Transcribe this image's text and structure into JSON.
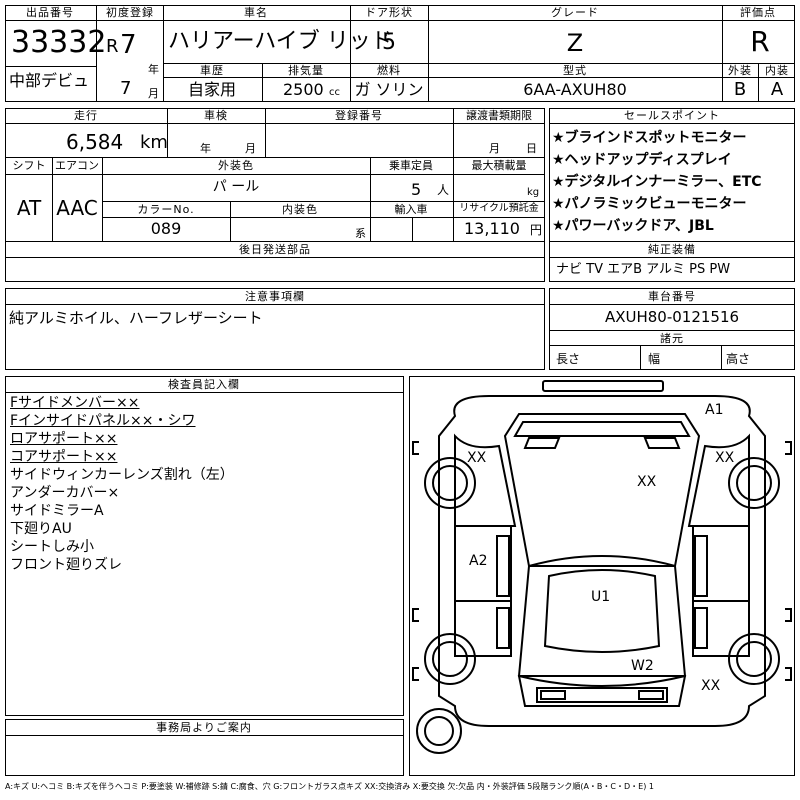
{
  "header_labels": {
    "lot_no": "出品番号",
    "first_reg": "初度登録",
    "car_name": "車名",
    "door": "ドア形状",
    "grade": "グレード",
    "score": "評価点",
    "year_unit": "年",
    "month_unit": "月",
    "history": "車歴",
    "displacement": "排気量",
    "fuel": "燃料",
    "model_code": "型式",
    "exterior": "外装",
    "interior": "内装"
  },
  "vehicle": {
    "lot_no": "33332",
    "first_reg_era": "R",
    "first_reg_year": "7",
    "first_reg_month": "7",
    "name": "ハリアーハイブ リッド",
    "debut": "中部デビュ",
    "door": "5",
    "grade": "Z",
    "score": "R",
    "history": "自家用",
    "displacement": "2500",
    "displacement_unit": "cc",
    "fuel": "ガ ソリン",
    "model_code": "6AA-AXUH80",
    "exterior_score": "B",
    "interior_score": "A"
  },
  "mid_labels": {
    "mileage": "走行",
    "inspection": "車検",
    "reg_no": "登録番号",
    "transfer_docs": "譲渡書類期限",
    "sales_points": "セールスポイント",
    "shift": "シフト",
    "aircon": "エアコン",
    "ext_color": "外装色",
    "capacity": "乗車定員",
    "max_load": "最大積載量",
    "color_no": "カラーNo.",
    "int_color": "内装色",
    "import": "輸入車",
    "recycle": "リサイクル預託金",
    "later_parts": "後日発送部品",
    "genuine": "純正装備",
    "inspection_year": "年",
    "inspection_month": "月",
    "docs_month": "月",
    "docs_day": "日",
    "capacity_unit": "人",
    "load_unit": "kg",
    "int_color_unit": "系",
    "recycle_unit": "円"
  },
  "details": {
    "mileage": "6,584",
    "mileage_unit": "km",
    "shift": "AT",
    "aircon": "AAC",
    "ext_color": "パ ール",
    "capacity": "5",
    "color_no": "089",
    "recycle": "13,110",
    "genuine": "ナビ TV エアB アルミ PS PW"
  },
  "sales_points": [
    "★ブラインドスポットモニター",
    "★ヘッドアップディスプレイ",
    "★デジタルインナーミラー、ETC",
    "★パノラミックビューモニター",
    "★パワーバックドア、JBL"
  ],
  "notes": {
    "label": "注意事項欄",
    "text": "純アルミホイル、ハーフレザーシート"
  },
  "chassis": {
    "label": "車台番号",
    "value": "AXUH80-0121516",
    "spec_label": "諸元",
    "length": "長さ",
    "width": "幅",
    "height": "高さ"
  },
  "inspector": {
    "label": "検査員記入欄",
    "lines": [
      {
        "text": "Fサイドメンバー××",
        "underline": true
      },
      {
        "text": "Fインサイドパネル××・シワ",
        "underline": true
      },
      {
        "text": "ロアサポート××",
        "underline": true
      },
      {
        "text": "コアサポート××",
        "underline": true
      },
      {
        "text": "サイドウィンカーレンズ割れ（左）",
        "underline": false
      },
      {
        "text": "アンダーカバー×",
        "underline": false
      },
      {
        "text": "サイドミラーA",
        "underline": false
      },
      {
        "text": "下廻りAU",
        "underline": false
      },
      {
        "text": "シートしみ小",
        "underline": false
      },
      {
        "text": "フロント廻りズレ",
        "underline": false
      }
    ]
  },
  "office": {
    "label": "事務局よりご案内"
  },
  "diagram_marks": {
    "a1": "A1",
    "xx_front_left": "XX",
    "xx_front_right": "XX",
    "xx_hood": "XX",
    "a2": "A2",
    "u1": "U1",
    "w2": "W2",
    "xx_rear_right": "XX"
  },
  "footer": "A:キズ U:ヘコミ B:キズを伴うヘコミ P:要塗装 W:補修跡 S:錆 C:腐食、穴 G:フロントガラス点キズ XX:交換済み X:要交換 欠:欠品 内・外装評価 5段階ランク順(A・B・C・D・E) 1"
}
